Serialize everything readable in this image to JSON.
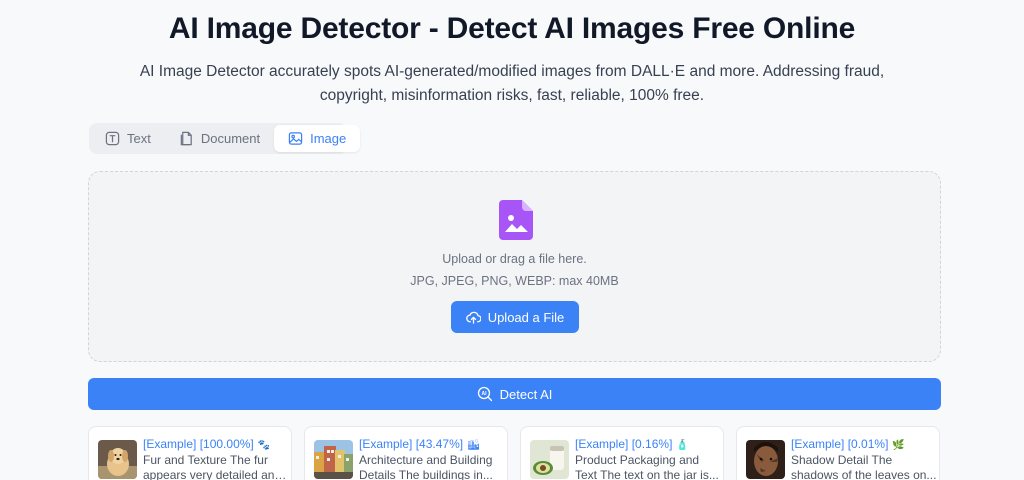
{
  "header": {
    "title": "AI Image Detector - Detect AI Images Free Online",
    "subtitle": "AI Image Detector accurately spots AI-generated/modified images from DALL·E and more. Addressing fraud, copyright, misinformation risks, fast, reliable, 100% free."
  },
  "tabs": [
    {
      "label": "Text",
      "icon": "text-icon",
      "active": false
    },
    {
      "label": "Document",
      "icon": "document-icon",
      "active": false
    },
    {
      "label": "Image",
      "icon": "image-icon",
      "active": true
    }
  ],
  "upload": {
    "icon": "image-file-icon",
    "prompt": "Upload or drag a file here.",
    "formats": "JPG, JPEG, PNG, WEBP: max 40MB",
    "button_label": "Upload a File"
  },
  "detect": {
    "button_label": "Detect AI"
  },
  "examples": [
    {
      "tag": "[Example]",
      "score": "[100.00%]",
      "emoji": "🐾",
      "description": "Fur and Texture The fur appears very detailed and soft..."
    },
    {
      "tag": "[Example]",
      "score": "[43.47%]",
      "emoji": "🏙",
      "description": "Architecture and Building Details The buildings in..."
    },
    {
      "tag": "[Example]",
      "score": "[0.16%]",
      "emoji": "🧴",
      "description": "Product Packaging and Text The text on the jar is..."
    },
    {
      "tag": "[Example]",
      "score": "[0.01%]",
      "emoji": "🌿",
      "description": "Shadow Detail The shadows of the leaves on..."
    }
  ],
  "colors": {
    "accent": "#3b82f6",
    "file_icon": "#a855f7",
    "background": "#f8f9fb"
  }
}
